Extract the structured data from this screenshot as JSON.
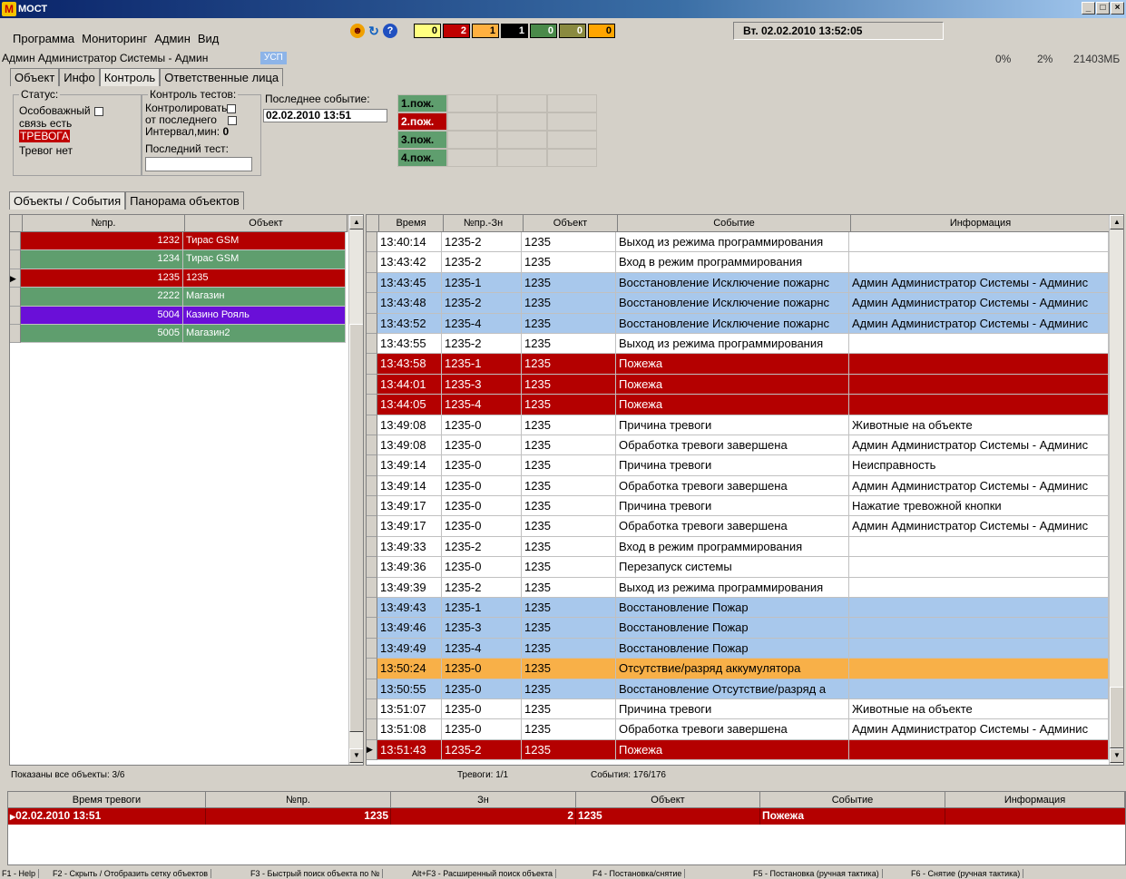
{
  "window": {
    "title": "МОСТ",
    "logo": "M",
    "buttons": [
      "_",
      "□",
      "×"
    ]
  },
  "menu": {
    "items": [
      "Программа",
      "Мониторинг",
      "Админ",
      "Вид"
    ]
  },
  "toolbar": {
    "icons": [
      "smiley-icon",
      "refresh-icon",
      "help-icon"
    ],
    "counters": [
      {
        "value": "0",
        "color": "#ffff80"
      },
      {
        "value": "2",
        "color": "#c00000"
      },
      {
        "value": "1",
        "color": "#ffb040"
      },
      {
        "value": "1",
        "color": "#000000"
      },
      {
        "value": "0",
        "color": "#4a8a4a"
      },
      {
        "value": "0",
        "color": "#8a8a40"
      },
      {
        "value": "0",
        "color": "#ffa500"
      }
    ],
    "datetime": "Вт. 02.02.2010  13:52:05"
  },
  "userbar": {
    "user": "Админ Администратор Системы - Админ",
    "badge": "УСП",
    "cpu": "0%",
    "mem": "2%",
    "disk": "21403МБ"
  },
  "tabs_top": [
    "Объект",
    "Инфо",
    "Контроль",
    "Ответственные лица"
  ],
  "status_group": {
    "title": "Статус:",
    "guarded": "Особоважный",
    "link": "связь есть",
    "alarm": "ТРЕВОГА",
    "no_alarms": "Тревог нет"
  },
  "tests_group": {
    "title": "Контроль тестов:",
    "control": "Контролировать",
    "from_last": "от последнего",
    "interval_label": "Интервал,мин:",
    "interval_value": "0",
    "last_test": "Последний тест:"
  },
  "last_event": {
    "label": "Последнее событие:",
    "value": "02.02.2010 13:51"
  },
  "fire_grid": [
    {
      "label": "1.пож.",
      "color": "#5f9e6e",
      "text": "#000"
    },
    {
      "label": "2.пож.",
      "color": "#b40000",
      "text": "#fff"
    },
    {
      "label": "3.пож.",
      "color": "#5f9e6e",
      "text": "#000"
    },
    {
      "label": "4.пож.",
      "color": "#5f9e6e",
      "text": "#000"
    }
  ],
  "tabs_mid": [
    "Объекты / События",
    "Панорама объектов"
  ],
  "objects": {
    "headers": [
      "№пр.",
      "Объект"
    ],
    "rows": [
      {
        "num": "1232",
        "name": "Тирас GSM",
        "color": "#b40000"
      },
      {
        "num": "1234",
        "name": "Тирас GSM",
        "color": "#5f9e6e"
      },
      {
        "num": "1235",
        "name": "1235",
        "color": "#b40000",
        "current": true
      },
      {
        "num": "2222",
        "name": "Магазин",
        "color": "#5f9e6e"
      },
      {
        "num": "5004",
        "name": "Казино Рояль",
        "color": "#6a0fd8"
      },
      {
        "num": "5005",
        "name": "Магазин2",
        "color": "#5f9e6e"
      }
    ]
  },
  "events": {
    "headers": [
      "Время",
      "№пр.-Зн",
      "Объект",
      "Событие",
      "Информация"
    ],
    "rows": [
      {
        "time": "13:40:14",
        "zone": "1235-2",
        "obj": "1235",
        "event": "Выход из режима программирования",
        "info": "",
        "color": "#ffffff"
      },
      {
        "time": "13:43:42",
        "zone": "1235-2",
        "obj": "1235",
        "event": "Вход в режим программирования",
        "info": "",
        "color": "#ffffff"
      },
      {
        "time": "13:43:45",
        "zone": "1235-1",
        "obj": "1235",
        "event": "Восстановление Исключение пожарнс",
        "info": "Админ Администратор Системы - Админис",
        "color": "#a8c8ec"
      },
      {
        "time": "13:43:48",
        "zone": "1235-2",
        "obj": "1235",
        "event": "Восстановление Исключение пожарнс",
        "info": "Админ Администратор Системы - Админис",
        "color": "#a8c8ec"
      },
      {
        "time": "13:43:52",
        "zone": "1235-4",
        "obj": "1235",
        "event": "Восстановление Исключение пожарнс",
        "info": "Админ Администратор Системы - Админис",
        "color": "#a8c8ec"
      },
      {
        "time": "13:43:55",
        "zone": "1235-2",
        "obj": "1235",
        "event": "Выход из режима программирования",
        "info": "",
        "color": "#ffffff"
      },
      {
        "time": "13:43:58",
        "zone": "1235-1",
        "obj": "1235",
        "event": "Пожежа",
        "info": "",
        "color": "#b40000"
      },
      {
        "time": "13:44:01",
        "zone": "1235-3",
        "obj": "1235",
        "event": "Пожежа",
        "info": "",
        "color": "#b40000"
      },
      {
        "time": "13:44:05",
        "zone": "1235-4",
        "obj": "1235",
        "event": "Пожежа",
        "info": "",
        "color": "#b40000"
      },
      {
        "time": "13:49:08",
        "zone": "1235-0",
        "obj": "1235",
        "event": "Причина тревоги",
        "info": "Животные на объекте",
        "color": "#ffffff"
      },
      {
        "time": "13:49:08",
        "zone": "1235-0",
        "obj": "1235",
        "event": "Обработка тревоги завершена",
        "info": "Админ Администратор Системы - Админис",
        "color": "#ffffff"
      },
      {
        "time": "13:49:14",
        "zone": "1235-0",
        "obj": "1235",
        "event": "Причина тревоги",
        "info": "Неисправность",
        "color": "#ffffff"
      },
      {
        "time": "13:49:14",
        "zone": "1235-0",
        "obj": "1235",
        "event": "Обработка тревоги завершена",
        "info": "Админ Администратор Системы - Админис",
        "color": "#ffffff"
      },
      {
        "time": "13:49:17",
        "zone": "1235-0",
        "obj": "1235",
        "event": "Причина тревоги",
        "info": "Нажатие тревожной кнопки",
        "color": "#ffffff"
      },
      {
        "time": "13:49:17",
        "zone": "1235-0",
        "obj": "1235",
        "event": "Обработка тревоги завершена",
        "info": "Админ Администратор Системы - Админис",
        "color": "#ffffff"
      },
      {
        "time": "13:49:33",
        "zone": "1235-2",
        "obj": "1235",
        "event": "Вход в режим программирования",
        "info": "",
        "color": "#ffffff"
      },
      {
        "time": "13:49:36",
        "zone": "1235-0",
        "obj": "1235",
        "event": "Перезапуск системы",
        "info": "",
        "color": "#ffffff"
      },
      {
        "time": "13:49:39",
        "zone": "1235-2",
        "obj": "1235",
        "event": "Выход из режима программирования",
        "info": "",
        "color": "#ffffff"
      },
      {
        "time": "13:49:43",
        "zone": "1235-1",
        "obj": "1235",
        "event": "Восстановление Пожар",
        "info": "",
        "color": "#a8c8ec"
      },
      {
        "time": "13:49:46",
        "zone": "1235-3",
        "obj": "1235",
        "event": "Восстановление Пожар",
        "info": "",
        "color": "#a8c8ec"
      },
      {
        "time": "13:49:49",
        "zone": "1235-4",
        "obj": "1235",
        "event": "Восстановление Пожар",
        "info": "",
        "color": "#a8c8ec"
      },
      {
        "time": "13:50:24",
        "zone": "1235-0",
        "obj": "1235",
        "event": "Отсутствие/разряд аккумулятора",
        "info": "",
        "color": "#f8b048"
      },
      {
        "time": "13:50:55",
        "zone": "1235-0",
        "obj": "1235",
        "event": "Восстановление Отсутствие/разряд а",
        "info": "",
        "color": "#a8c8ec"
      },
      {
        "time": "13:51:07",
        "zone": "1235-0",
        "obj": "1235",
        "event": "Причина тревоги",
        "info": "Животные на объекте",
        "color": "#ffffff"
      },
      {
        "time": "13:51:08",
        "zone": "1235-0",
        "obj": "1235",
        "event": "Обработка тревоги завершена",
        "info": "Админ Администратор Системы - Админис",
        "color": "#ffffff"
      },
      {
        "time": "13:51:43",
        "zone": "1235-2",
        "obj": "1235",
        "event": "Пожежа",
        "info": "",
        "color": "#b40000",
        "current": true
      }
    ]
  },
  "statusbar": {
    "objects": "Показаны все объекты: 3/6",
    "alarms": "Тревоги: 1/1",
    "events": "События: 176/176"
  },
  "alarms": {
    "headers": [
      "Время тревоги",
      "№пр.",
      "Зн",
      "Объект",
      "Событие",
      "Информация"
    ],
    "rows": [
      {
        "time": "02.02.2010 13:51",
        "num": "1235",
        "zone": "2",
        "obj": "1235",
        "event": "Пожежа",
        "info": ""
      }
    ]
  },
  "fkeys": [
    "F1 - Help",
    "F2 - Скрыть / Отобразить сетку объектов",
    "F3 - Быстрый поиск объекта по №",
    "Alt+F3 - Расширенный поиск объекта",
    "F4 - Постановка/снятие",
    "F5 - Постановка (ручная тактика)",
    "F6 - Снятие (ручная тактика)"
  ]
}
